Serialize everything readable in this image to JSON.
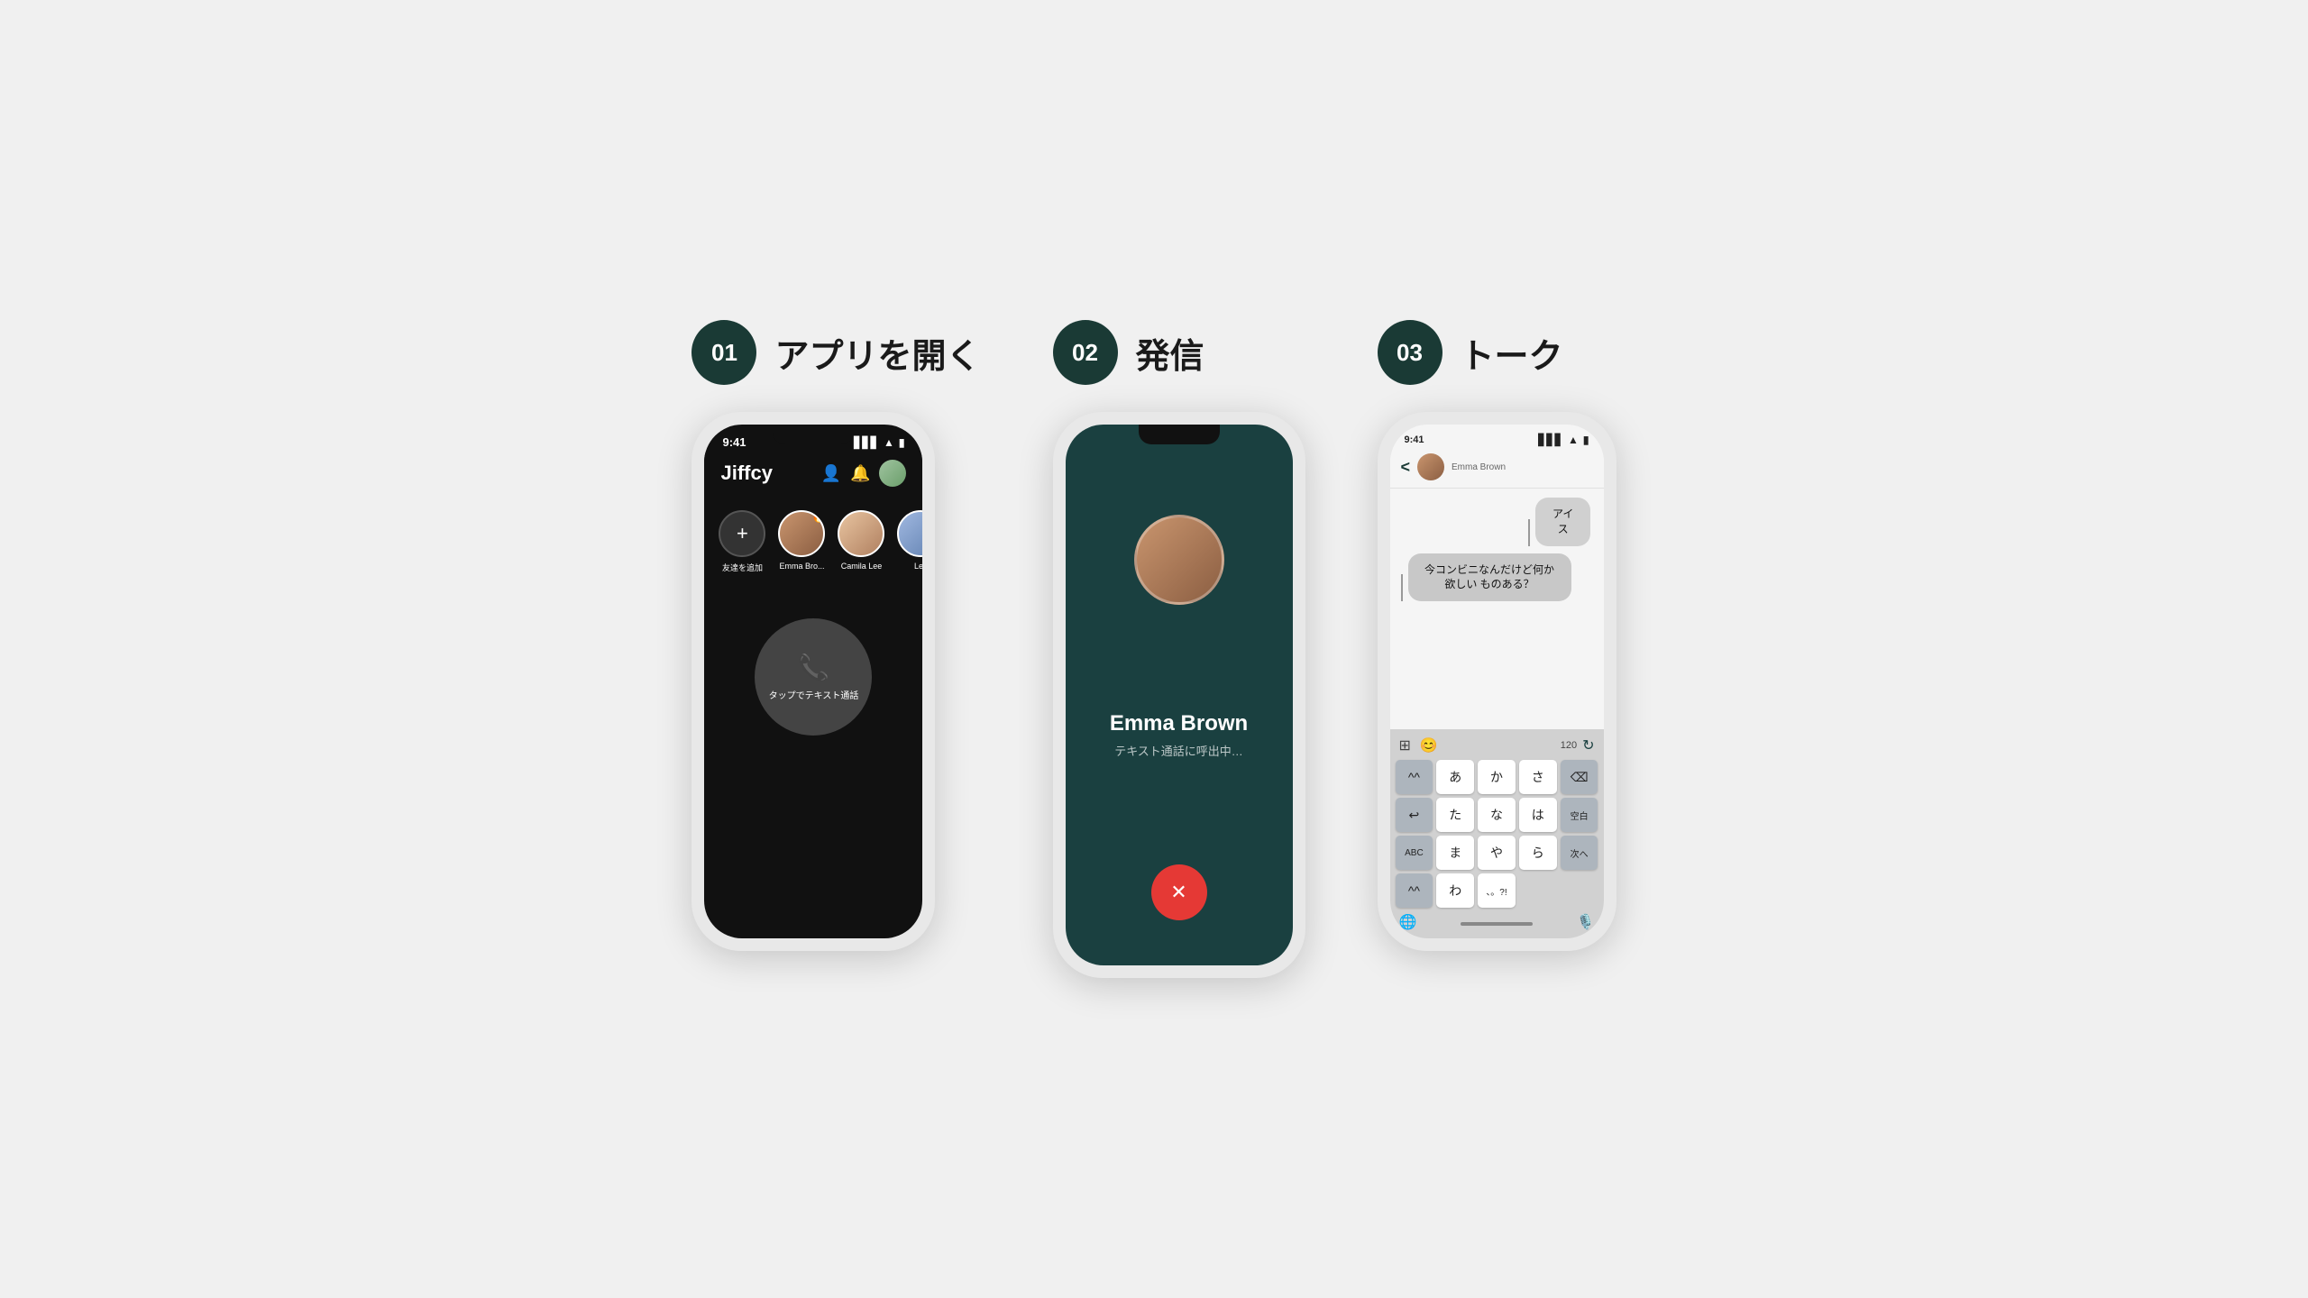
{
  "background": "#f0f0f0",
  "steps": [
    {
      "number": "01",
      "title": "アプリを開く",
      "phone": {
        "time": "9:41",
        "app_name": "Jiffcy",
        "friends": [
          {
            "label": "友達を追加",
            "type": "add"
          },
          {
            "name": "Emma Bro...",
            "type": "avatar",
            "fire": true
          },
          {
            "name": "Camila Lee",
            "type": "avatar2"
          },
          {
            "name": "Leo",
            "type": "avatar3"
          }
        ],
        "call_label": "タップでテキスト通話"
      }
    },
    {
      "number": "02",
      "title": "発信",
      "phone": {
        "caller_name": "Emma Brown",
        "call_status": "テキスト通話に呼出中…",
        "end_button": "✕"
      }
    },
    {
      "number": "03",
      "title": "トーク",
      "phone": {
        "time": "9:41",
        "contact_name": "Emma Brown",
        "messages": [
          {
            "text": "アイス",
            "type": "received"
          },
          {
            "text": "今コンビニなんだけど何か欲しい\nものある？",
            "type": "sent"
          }
        ],
        "counter": "120",
        "keyboard_rows": [
          [
            "^^",
            "あ",
            "か",
            "さ",
            "⌫"
          ],
          [
            "↩",
            "た",
            "な",
            "は",
            "空白"
          ],
          [
            "ABC",
            "ま",
            "や",
            "ら",
            "次へ"
          ],
          [
            "^^",
            "わ",
            "、。?!",
            ""
          ]
        ]
      }
    }
  ]
}
